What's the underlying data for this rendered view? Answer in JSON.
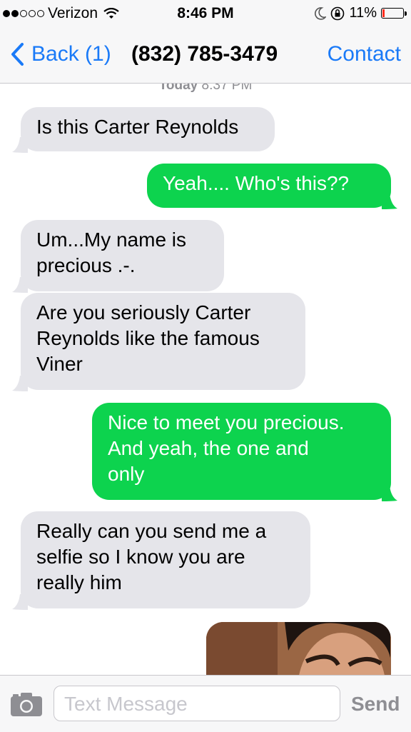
{
  "status_bar": {
    "carrier": "Verizon",
    "time": "8:46 PM",
    "battery_percent": "11%",
    "battery_level": 0.11,
    "icons": [
      "signal-dots-icon",
      "wifi-icon",
      "moon-icon",
      "rotation-lock-icon",
      "battery-icon"
    ]
  },
  "nav": {
    "back_label": "Back (1)",
    "title": "(832) 785-3479",
    "contact_label": "Contact",
    "accent_color": "#1a7af8"
  },
  "conversation": {
    "timestamp_day": "Today",
    "timestamp_time": "8:37 PM",
    "messages": [
      {
        "direction": "incoming",
        "lines": [
          "Is this Carter Reynolds"
        ]
      },
      {
        "direction": "outgoing",
        "lines": [
          "Yeah.... Who's this??"
        ]
      },
      {
        "direction": "incoming",
        "lines": [
          "Um...My name is",
          "precious .-."
        ]
      },
      {
        "direction": "incoming",
        "lines": [
          "Are you seriously Carter",
          "Reynolds like the famous",
          "Viner"
        ]
      },
      {
        "direction": "outgoing",
        "lines": [
          "Nice to meet you precious.",
          "And yeah, the one and",
          "only"
        ]
      },
      {
        "direction": "incoming",
        "lines": [
          "Really can you send me a",
          "selfie so I know you are",
          "really him"
        ]
      }
    ],
    "outgoing_color": "#0dd34e",
    "incoming_color": "#e5e5ea"
  },
  "input_bar": {
    "placeholder": "Text Message",
    "send_label": "Send"
  }
}
